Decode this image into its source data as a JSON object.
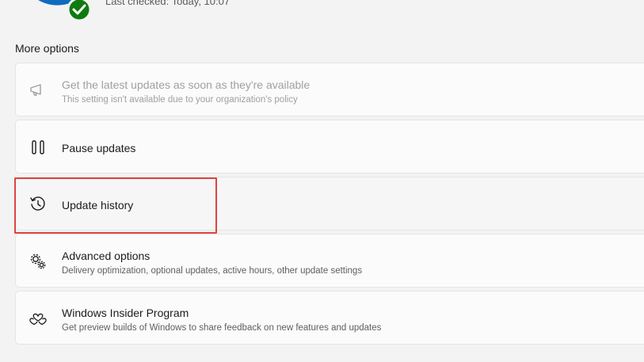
{
  "status": {
    "last_checked": "Last checked: Today, 10:07"
  },
  "section": {
    "title": "More options"
  },
  "options": [
    {
      "title": "Get the latest updates as soon as they're available",
      "subtitle": "This setting isn't available due to your organization's policy",
      "icon": "megaphone-icon",
      "disabled": true
    },
    {
      "title": "Pause updates",
      "subtitle": "",
      "icon": "pause-icon"
    },
    {
      "title": "Update history",
      "subtitle": "",
      "icon": "history-icon",
      "highlighted": true
    },
    {
      "title": "Advanced options",
      "subtitle": "Delivery optimization, optional updates, active hours, other update settings",
      "icon": "gears-icon"
    },
    {
      "title": "Windows Insider Program",
      "subtitle": "Get preview builds of Windows to share feedback on new features and updates",
      "icon": "insider-hearts-icon"
    }
  ],
  "colors": {
    "accent": "#0f6cbd",
    "success": "#0f7b0f",
    "highlight_border": "#e0443f",
    "background": "#f3f3f3",
    "card": "#fbfbfb"
  }
}
